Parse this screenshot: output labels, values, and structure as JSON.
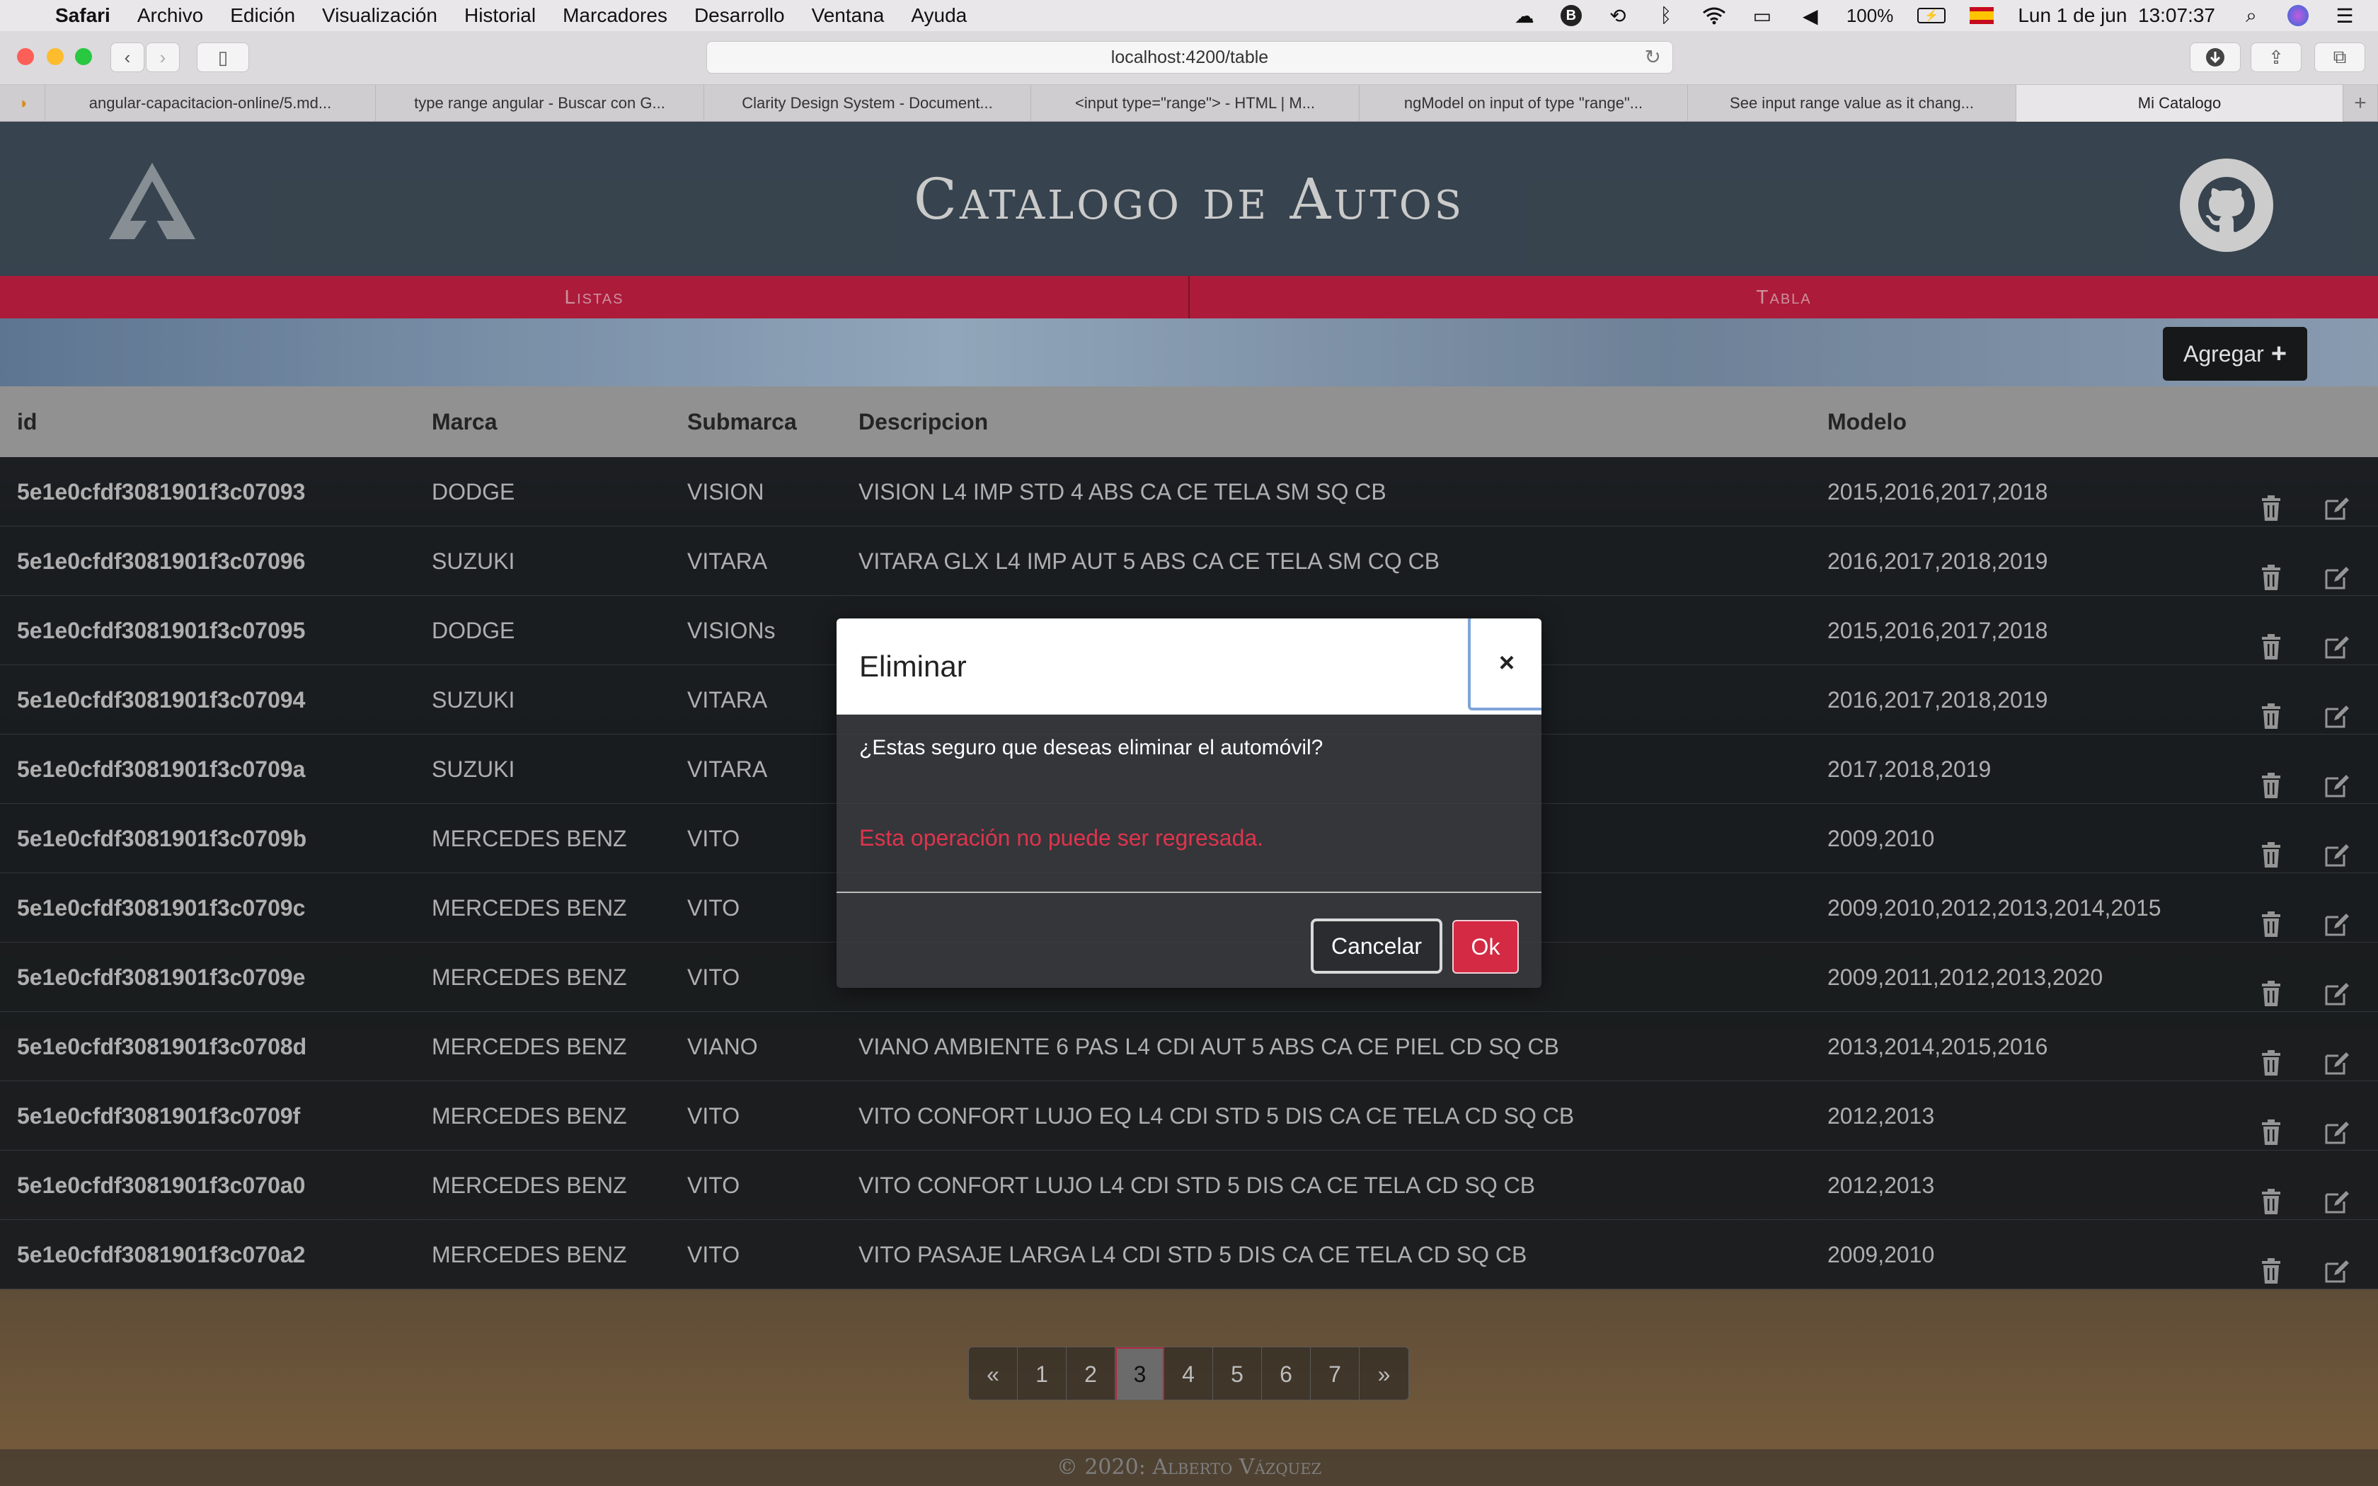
{
  "menubar": {
    "app_name": "Safari",
    "items": [
      "Archivo",
      "Edición",
      "Visualización",
      "Historial",
      "Marcadores",
      "Desarrollo",
      "Ventana",
      "Ayuda"
    ],
    "battery": "100%",
    "datetime": "Lun 1 de jun  13:07:37"
  },
  "browser": {
    "url": "localhost:4200/table",
    "tabs": [
      "angular-capacitacion-online/5.md...",
      "type range angular - Buscar con G...",
      "Clarity Design System - Document...",
      "<input type=\"range\"> - HTML | M...",
      "ngModel on input of type \"range\"...",
      "See input range value as it chang...",
      "Mi Catalogo"
    ],
    "active_tab": 6
  },
  "app": {
    "title": "Catalogo de Autos",
    "nav": [
      "Listas",
      "Tabla"
    ],
    "add_button": "Agregar",
    "columns": [
      "id",
      "Marca",
      "Submarca",
      "Descripcion",
      "Modelo"
    ],
    "rows": [
      {
        "id": "5e1e0cfdf3081901f3c07093",
        "marca": "DODGE",
        "submarca": "VISION",
        "descripcion": "VISION L4 IMP STD 4 ABS CA CE TELA SM SQ CB",
        "modelo": "2015,2016,2017,2018"
      },
      {
        "id": "5e1e0cfdf3081901f3c07096",
        "marca": "SUZUKI",
        "submarca": "VITARA",
        "descripcion": "VITARA GLX L4 IMP AUT 5 ABS CA CE TELA SM CQ CB",
        "modelo": "2016,2017,2018,2019"
      },
      {
        "id": "5e1e0cfdf3081901f3c07095",
        "marca": "DODGE",
        "submarca": "VISIONs",
        "descripcion": "",
        "modelo": "2015,2016,2017,2018"
      },
      {
        "id": "5e1e0cfdf3081901f3c07094",
        "marca": "SUZUKI",
        "submarca": "VITARA",
        "descripcion": "",
        "modelo": "2016,2017,2018,2019"
      },
      {
        "id": "5e1e0cfdf3081901f3c0709a",
        "marca": "SUZUKI",
        "submarca": "VITARA",
        "descripcion": "",
        "modelo": "2017,2018,2019"
      },
      {
        "id": "5e1e0cfdf3081901f3c0709b",
        "marca": "MERCEDES BENZ",
        "submarca": "VITO",
        "descripcion": "",
        "modelo": "2009,2010"
      },
      {
        "id": "5e1e0cfdf3081901f3c0709c",
        "marca": "MERCEDES BENZ",
        "submarca": "VITO",
        "descripcion": "",
        "modelo": "2009,2010,2012,2013,2014,2015"
      },
      {
        "id": "5e1e0cfdf3081901f3c0709e",
        "marca": "MERCEDES BENZ",
        "submarca": "VITO",
        "descripcion": "",
        "modelo": "2009,2011,2012,2013,2020"
      },
      {
        "id": "5e1e0cfdf3081901f3c0708d",
        "marca": "MERCEDES BENZ",
        "submarca": "VIANO",
        "descripcion": "VIANO AMBIENTE 6 PAS L4 CDI AUT 5 ABS CA CE PIEL CD SQ CB",
        "modelo": "2013,2014,2015,2016"
      },
      {
        "id": "5e1e0cfdf3081901f3c0709f",
        "marca": "MERCEDES BENZ",
        "submarca": "VITO",
        "descripcion": "VITO CONFORT LUJO EQ L4 CDI STD 5 DIS CA CE TELA CD SQ CB",
        "modelo": "2012,2013"
      },
      {
        "id": "5e1e0cfdf3081901f3c070a0",
        "marca": "MERCEDES BENZ",
        "submarca": "VITO",
        "descripcion": "VITO CONFORT LUJO L4 CDI STD 5 DIS CA CE TELA CD SQ CB",
        "modelo": "2012,2013"
      },
      {
        "id": "5e1e0cfdf3081901f3c070a2",
        "marca": "MERCEDES BENZ",
        "submarca": "VITO",
        "descripcion": "VITO PASAJE LARGA L4 CDI STD 5 DIS CA CE TELA CD SQ CB",
        "modelo": "2009,2010"
      }
    ],
    "pagination": {
      "prev": "«",
      "next": "»",
      "pages": [
        "1",
        "2",
        "3",
        "4",
        "5",
        "6",
        "7"
      ],
      "current": "3"
    },
    "footer": "© 2020: Alberto Vázquez"
  },
  "modal": {
    "title": "Eliminar",
    "close": "×",
    "question": "¿Estas seguro que deseas eliminar el automóvil?",
    "warning": "Esta operación no puede ser regresada.",
    "cancel": "Cancelar",
    "ok": "Ok"
  },
  "colors": {
    "accent": "#c51f43",
    "danger": "#d42a44",
    "warning_text": "#e0344d"
  }
}
